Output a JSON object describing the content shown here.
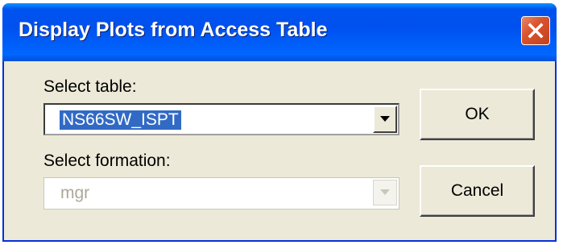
{
  "window": {
    "title": "Display Plots from Access Table",
    "close_icon": "close-icon"
  },
  "form": {
    "table_label": "Select table:",
    "table_value": "NS66SW_ISPT",
    "formation_label": "Select formation:",
    "formation_value": "mgr"
  },
  "buttons": {
    "ok_label": "OK",
    "cancel_label": "Cancel"
  },
  "colors": {
    "titlebar": "#0055ea",
    "dialog_background": "#ece9d8",
    "selection": "#316ac5",
    "close_button": "#d9532e"
  }
}
